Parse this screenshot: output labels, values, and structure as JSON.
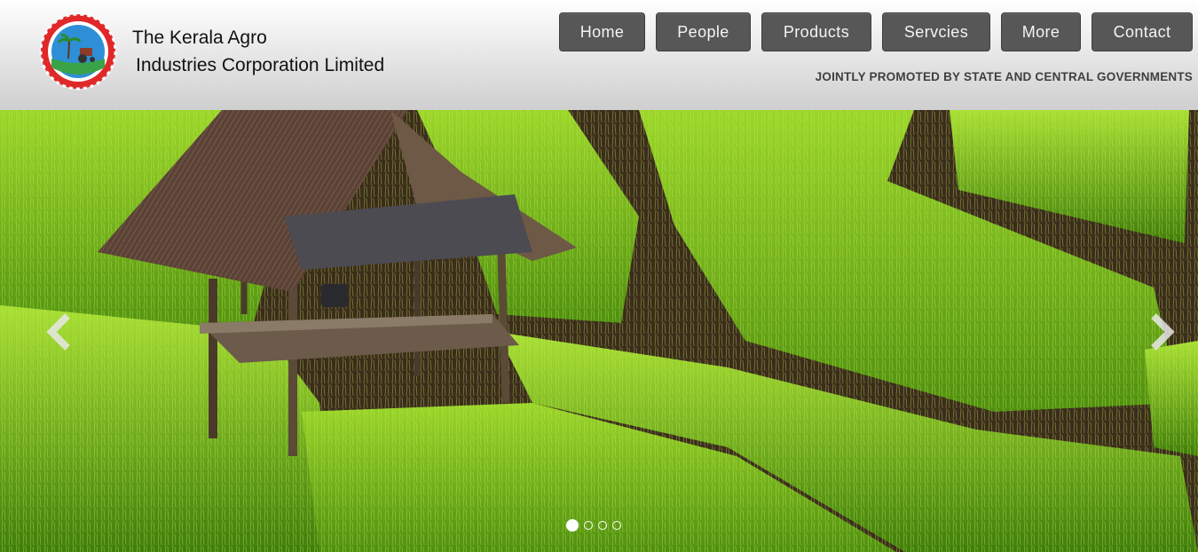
{
  "header": {
    "brand_line1": "The Kerala Agro",
    "brand_line2": "Industries Corporation Limited",
    "tagline": "JOINTLY PROMOTED BY STATE AND CENTRAL GOVERNMENTS"
  },
  "nav": {
    "items": [
      "Home",
      "People",
      "Products",
      "Servcies",
      "More",
      "Contact"
    ]
  },
  "carousel": {
    "slide_count": 4,
    "active_index": 0
  },
  "colors": {
    "nav_button": "#575757",
    "logo_ring": "#e02828",
    "rice_green": "#7dc21e"
  }
}
